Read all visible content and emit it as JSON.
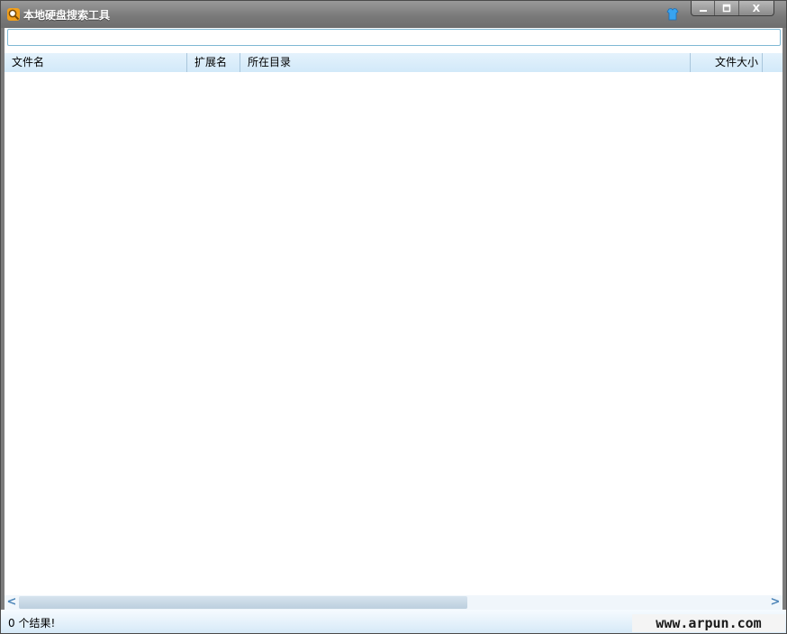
{
  "window": {
    "title": "本地硬盘搜索工具",
    "controls": {
      "minimize": "—",
      "maximize": "□",
      "close": "X"
    }
  },
  "search": {
    "value": "",
    "placeholder": ""
  },
  "table": {
    "columns": [
      "文件名",
      "扩展名",
      "所在目录",
      "文件大小"
    ],
    "rows": []
  },
  "scrollbar": {
    "left_arrow": "<",
    "right_arrow": ">"
  },
  "status": {
    "text": "0 个结果!"
  },
  "watermark": "www.arpun.com",
  "colors": {
    "header_bg": "#d2e9f9",
    "input_border": "#7fb8d4",
    "title_bar": "#7a7a7a"
  },
  "icons": {
    "app": "search-magnifier-icon",
    "skin": "skin-shirt-icon"
  }
}
